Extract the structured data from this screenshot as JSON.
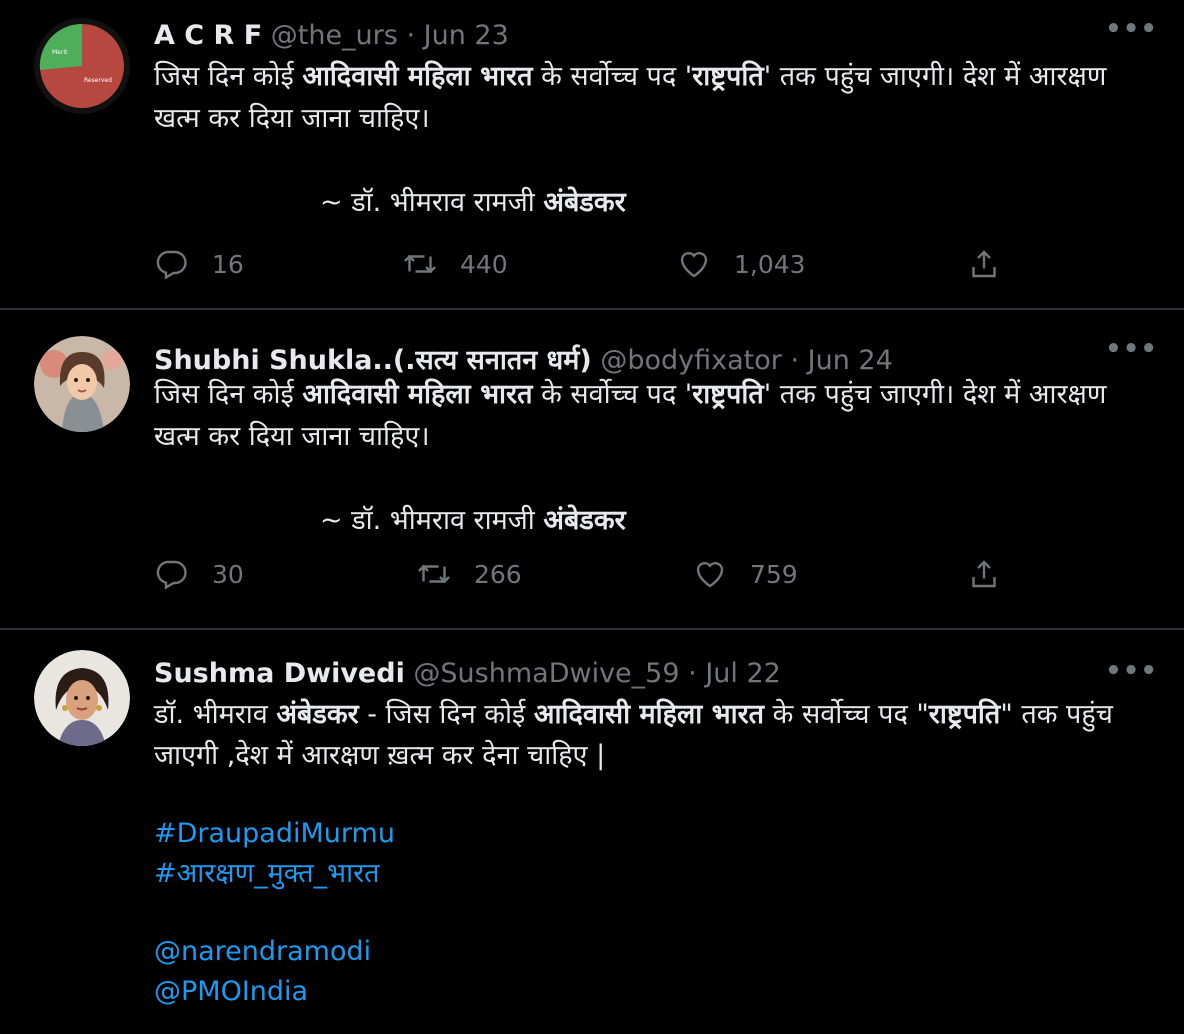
{
  "tweets": [
    {
      "name": "A C R F",
      "handle": "@the_urs",
      "separator": "·",
      "date": "Jun 23",
      "avatar": {
        "kind": "pie-chart",
        "labels": [
          "Merit",
          "Reserved"
        ],
        "colors": [
          "#4fae5a",
          "#b7483f"
        ]
      },
      "body": {
        "p1_a": "जिस दिन कोई ",
        "p1_b": "आदिवासी महिला भारत",
        "p1_c": " के सर्वोच्च पद '",
        "p1_d": "राष्ट्रपति",
        "p1_e": "' तक पहुंच जाएगी। देश में आरक्षण खत्म कर दिया जाना चाहिए।",
        "sig_a": "~ डॉ. भीमराव रामजी ",
        "sig_b": "अंबेडकर"
      },
      "replies": "16",
      "retweets": "440",
      "likes": "1,043"
    },
    {
      "name": "Shubhi Shukla..(.सत्य सनातन धर्म)",
      "handle": "@bodyfixator",
      "separator": "·",
      "date": "Jun 24",
      "avatar": {
        "kind": "illustrated-portrait"
      },
      "body": {
        "p1_a": "जिस दिन कोई ",
        "p1_b": "आदिवासी महिला भारत",
        "p1_c": " के सर्वोच्च पद '",
        "p1_d": "राष्ट्रपति",
        "p1_e": "' तक पहुंच जाएगी। देश में आरक्षण खत्म कर दिया जाना चाहिए।",
        "sig_a": "~ डॉ. भीमराव रामजी ",
        "sig_b": "अंबेडकर"
      },
      "replies": "30",
      "retweets": "266",
      "likes": "759"
    },
    {
      "name": "Sushma Dwivedi",
      "handle": "@SushmaDwive_59",
      "separator": "·",
      "date": "Jul 22",
      "avatar": {
        "kind": "photo-portrait"
      },
      "body": {
        "a": "डॉ. भीमराव ",
        "b": "अंबेडकर",
        "c": " - जिस दिन कोई ",
        "d": "आदिवासी महिला भारत",
        "e": " के सर्वोच्च पद \"",
        "f": "राष्ट्रपति",
        "g": "\" तक पहुंच जाएगी ,देश में आरक्षण ख़त्म कर देना चाहिए |",
        "hashtag1": " #DraupadiMurmu",
        "hashtag2": "#आरक्षण_मुक्त_भारत",
        "mention1": "@narendramodi",
        "mention2": "@PMOIndia"
      }
    }
  ],
  "more_glyph": "•••",
  "colors": {
    "background": "#000000",
    "text": "#e7e9ea",
    "muted": "#71767b",
    "link": "#1d9bf0",
    "divider": "#2f3336"
  },
  "icons": [
    "reply-icon",
    "retweet-icon",
    "like-icon",
    "share-icon",
    "more-icon"
  ]
}
